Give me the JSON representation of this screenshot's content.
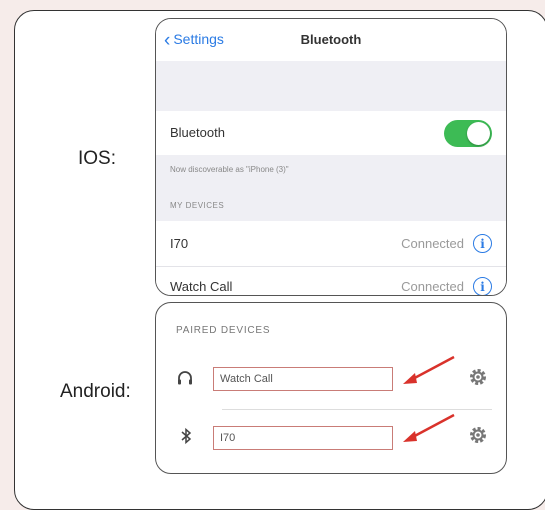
{
  "labels": {
    "ios": "IOS:",
    "android": "Android:"
  },
  "ios": {
    "nav": {
      "back_label": "Settings",
      "title": "Bluetooth"
    },
    "bluetooth_row": {
      "label": "Bluetooth",
      "toggle_on": true
    },
    "discover_note": "Now discoverable as \"iPhone (3)\"",
    "section_header": "MY DEVICES",
    "devices": [
      {
        "name": "I70",
        "status": "Connected"
      },
      {
        "name": "Watch Call",
        "status": "Connected"
      }
    ]
  },
  "android": {
    "header": "PAIRED DEVICES",
    "devices": [
      {
        "name": "Watch Call",
        "icon": "headphones-icon"
      },
      {
        "name": "I70",
        "icon": "bluetooth-icon"
      }
    ]
  },
  "colors": {
    "accent_blue": "#2b7be4",
    "toggle_green": "#3dbb55",
    "arrow_red": "#d9322b"
  }
}
